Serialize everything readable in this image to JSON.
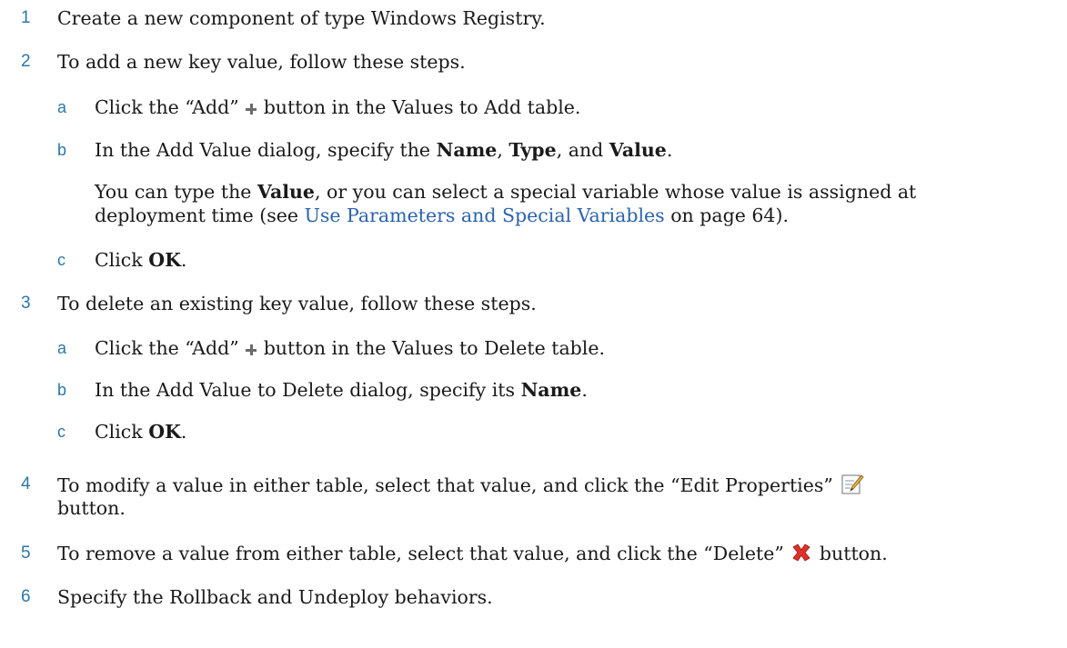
{
  "steps": {
    "s1": {
      "num": "1",
      "text": "Create a new component of type Windows Registry."
    },
    "s2": {
      "num": "2",
      "text": "To add a new key value, follow these steps."
    },
    "s2a": {
      "letter": "a",
      "pre": "Click the “Add”",
      "post": "button in the Values to Add table."
    },
    "s2b": {
      "letter": "b",
      "pre": "In the Add Value dialog, specify the ",
      "name": "Name",
      "comma1": ", ",
      "type": "Type",
      "comma2": ", and ",
      "value": "Value",
      "end": "."
    },
    "s2b_note": {
      "pre": "You can type the ",
      "value": "Value",
      "post": ", or you can select a special variable whose value is assigned at",
      "line2_pre": "deployment time (see ",
      "link": "Use Parameters and Special Variables",
      "line2_post": " on page 64)."
    },
    "s2c": {
      "letter": "c",
      "pre": "Click ",
      "ok": "OK",
      "end": "."
    },
    "s3": {
      "num": "3",
      "text": "To delete an existing key value, follow these steps."
    },
    "s3a": {
      "letter": "a",
      "pre": "Click the “Add”",
      "post": "button in the Values to Delete table."
    },
    "s3b": {
      "letter": "b",
      "pre": "In the Add Value to Delete dialog, specify its ",
      "name": "Name",
      "end": "."
    },
    "s3c": {
      "letter": "c",
      "pre": "Click ",
      "ok": "OK",
      "end": "."
    },
    "s4": {
      "num": "4",
      "line1": "To modify a value in either table, select that value, and click the “Edit Properties”",
      "line2": "button."
    },
    "s5": {
      "num": "5",
      "pre": "To remove a value from either table, select that value, and click the “Delete”",
      "post": "button."
    },
    "s6": {
      "num": "6",
      "text": "Specify the Rollback and Undeploy behaviors."
    }
  },
  "icons": {
    "add": "plus-icon",
    "edit": "edit-properties-icon",
    "delete": "delete-x-icon"
  }
}
